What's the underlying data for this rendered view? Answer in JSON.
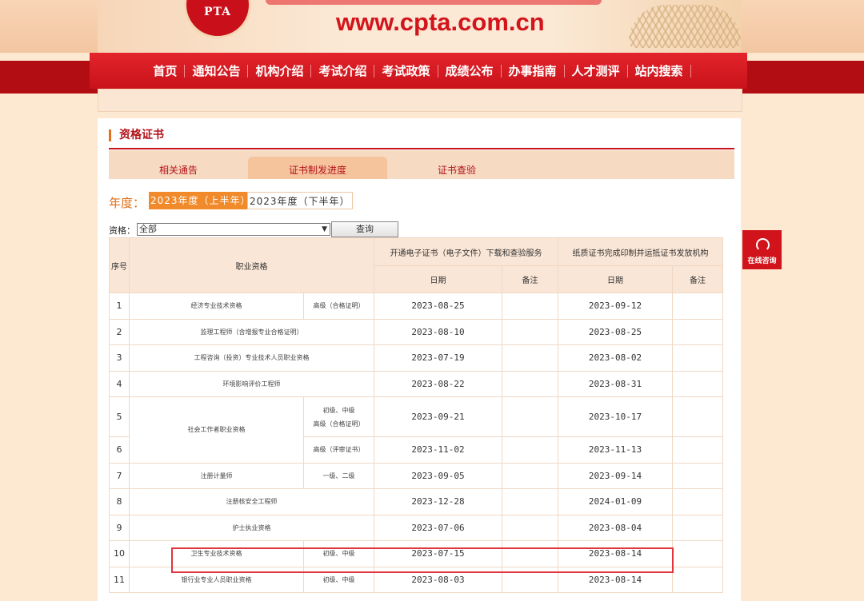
{
  "header": {
    "logo_text": "PTA",
    "site_url": "www.cpta.com.cn"
  },
  "nav": [
    "首页",
    "通知公告",
    "机构介绍",
    "考试介绍",
    "考试政策",
    "成绩公布",
    "办事指南",
    "人才测评",
    "站内搜索"
  ],
  "section": {
    "title": "资格证书",
    "tabs": [
      "相关通告",
      "证书制发进度",
      "证书查验"
    ],
    "active_tab": "证书制发进度"
  },
  "year": {
    "label": "年度：",
    "options": [
      "2023年度（上半年）",
      "2023年度（下半年）"
    ],
    "selected": "2023年度（上半年）"
  },
  "filter": {
    "label": "资格：",
    "selected": "全部",
    "button": "查询"
  },
  "table": {
    "headers": {
      "index": "序号",
      "qualification": "职业资格",
      "group_electronic": "开通电子证书（电子文件）下载和查验服务",
      "group_paper": "纸质证书完成印制并运抵证书发放机构",
      "date": "日期",
      "note": "备注"
    },
    "rows": [
      {
        "idx": "1",
        "name": "经济专业技术资格",
        "level": "高级（合格证明）",
        "e_date": "2023-08-25",
        "p_date": "2023-09-12"
      },
      {
        "idx": "2",
        "name": "监理工程师（含增报专业合格证明）",
        "level": "",
        "e_date": "2023-08-10",
        "p_date": "2023-08-25"
      },
      {
        "idx": "3",
        "name": "工程咨询（投资）专业技术人员职业资格",
        "level": "",
        "e_date": "2023-07-19",
        "p_date": "2023-08-02"
      },
      {
        "idx": "4",
        "name": "环境影响评价工程师",
        "level": "",
        "e_date": "2023-08-22",
        "p_date": "2023-08-31"
      },
      {
        "idx": "5",
        "name": "社会工作者职业资格",
        "level": "初级、中级",
        "level2": "高级（合格证明）",
        "e_date": "2023-09-21",
        "p_date": "2023-10-17"
      },
      {
        "idx": "6",
        "name": "",
        "level": "高级（评审证书）",
        "e_date": "2023-11-02",
        "p_date": "2023-11-13"
      },
      {
        "idx": "7",
        "name": "注册计量师",
        "level": "一级、二级",
        "e_date": "2023-09-05",
        "p_date": "2023-09-14"
      },
      {
        "idx": "8",
        "name": "注册核安全工程师",
        "level": "",
        "e_date": "2023-12-28",
        "p_date": "2024-01-09"
      },
      {
        "idx": "9",
        "name": "护士执业资格",
        "level": "",
        "e_date": "2023-07-06",
        "p_date": "2023-08-04"
      },
      {
        "idx": "10",
        "name": "卫生专业技术资格",
        "level": "初级、中级",
        "e_date": "2023-07-15",
        "p_date": "2023-08-14"
      },
      {
        "idx": "11",
        "name": "银行业专业人员职业资格",
        "level": "初级、中级",
        "e_date": "2023-08-03",
        "p_date": "2023-08-14"
      }
    ]
  },
  "consult": {
    "label": "在线咨询"
  },
  "colors": {
    "brand_red": "#d1141b",
    "accent_orange": "#f08a2a",
    "header_fill": "#fae6d6",
    "highlight_border": "#e0353d"
  }
}
